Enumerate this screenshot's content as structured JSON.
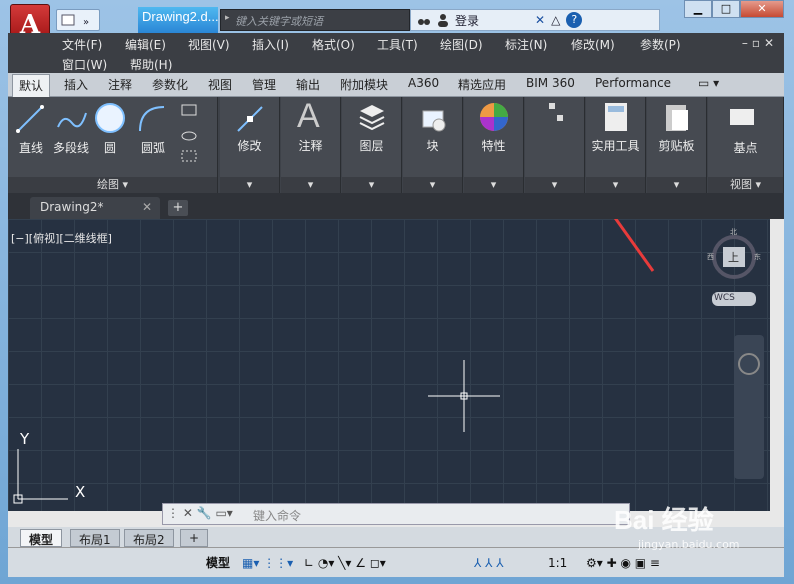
{
  "app": {
    "logo_letter": "A",
    "logo_caret": "▾",
    "doc_title": "Drawing2.d...",
    "search_placeholder": "键入关键字或短语",
    "login": "登录",
    "colors": {
      "accent": "#2a86d6",
      "logo": "#c02020",
      "canvas": "#263141"
    }
  },
  "menubar": {
    "row1": [
      "文件(F)",
      "编辑(E)",
      "视图(V)",
      "插入(I)",
      "格式(O)",
      "工具(T)",
      "绘图(D)",
      "标注(N)",
      "修改(M)",
      "参数(P)"
    ],
    "row2": [
      "窗口(W)",
      "帮助(H)"
    ]
  },
  "ribbon_tabs": [
    "默认",
    "插入",
    "注释",
    "参数化",
    "视图",
    "管理",
    "输出",
    "附加模块",
    "A360",
    "精选应用",
    "BIM 360",
    "Performance"
  ],
  "ribbon": {
    "draw": {
      "line": "直线",
      "polyline": "多段线",
      "circle": "圆",
      "arc": "圆弧",
      "footer": "绘图 ▾"
    },
    "panels": [
      "修改",
      "注释",
      "图层",
      "块",
      "特性",
      "组",
      "实用工具",
      "剪贴板",
      "基点"
    ],
    "view_footer": "视图 ▾"
  },
  "doc_tab": {
    "name": "Drawing2*",
    "close": "✕",
    "new": "+"
  },
  "canvas": {
    "view_label": "[−][俯视][二维线框]",
    "axis_x": "X",
    "axis_y": "Y",
    "viewcube_top": "上",
    "north": "北",
    "west": "西",
    "east": "东",
    "wcs": "WCS"
  },
  "command": {
    "placeholder": "键入命令"
  },
  "layouts": [
    "模型",
    "布局1",
    "布局2",
    "+"
  ],
  "status": {
    "model": "模型",
    "scale": "1:1"
  },
  "watermark": {
    "main": "Bai 经验",
    "sub": "jingyan.baidu.com"
  }
}
